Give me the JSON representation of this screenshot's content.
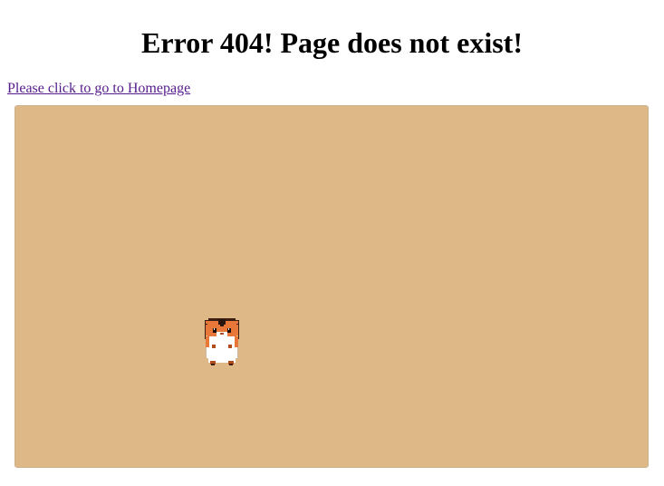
{
  "heading": "Error 404! Page does not exist!",
  "home_link": {
    "label": "Please click to go to Homepage"
  },
  "game": {
    "background_color": "#dfb887",
    "character": {
      "kind": "hamster",
      "icon": "hamster-sprite-icon",
      "fur_color": "#e8783a",
      "belly_color": "#ffffff"
    }
  }
}
